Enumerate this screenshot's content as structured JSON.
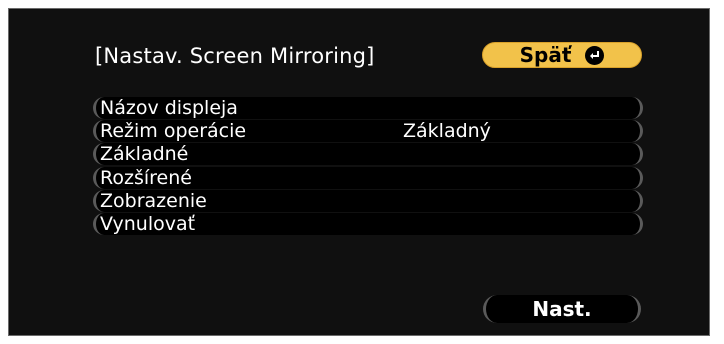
{
  "dialog": {
    "title": "[Nastav. Screen Mirroring]",
    "back_label": "Späť",
    "back_icon": "enter-icon",
    "apply_label": "Nast."
  },
  "menu": {
    "items": [
      {
        "label": "Názov displeja",
        "value": ""
      },
      {
        "label": "Režim operácie",
        "value": "Základný"
      },
      {
        "label": "Základné",
        "value": ""
      },
      {
        "label": "Rozšírené",
        "value": ""
      },
      {
        "label": "Zobrazenie",
        "value": ""
      },
      {
        "label": "Vynulovať",
        "value": ""
      }
    ]
  },
  "colors": {
    "background": "#101010",
    "accent_button": "#f2c24a",
    "text": "#ffffff"
  }
}
